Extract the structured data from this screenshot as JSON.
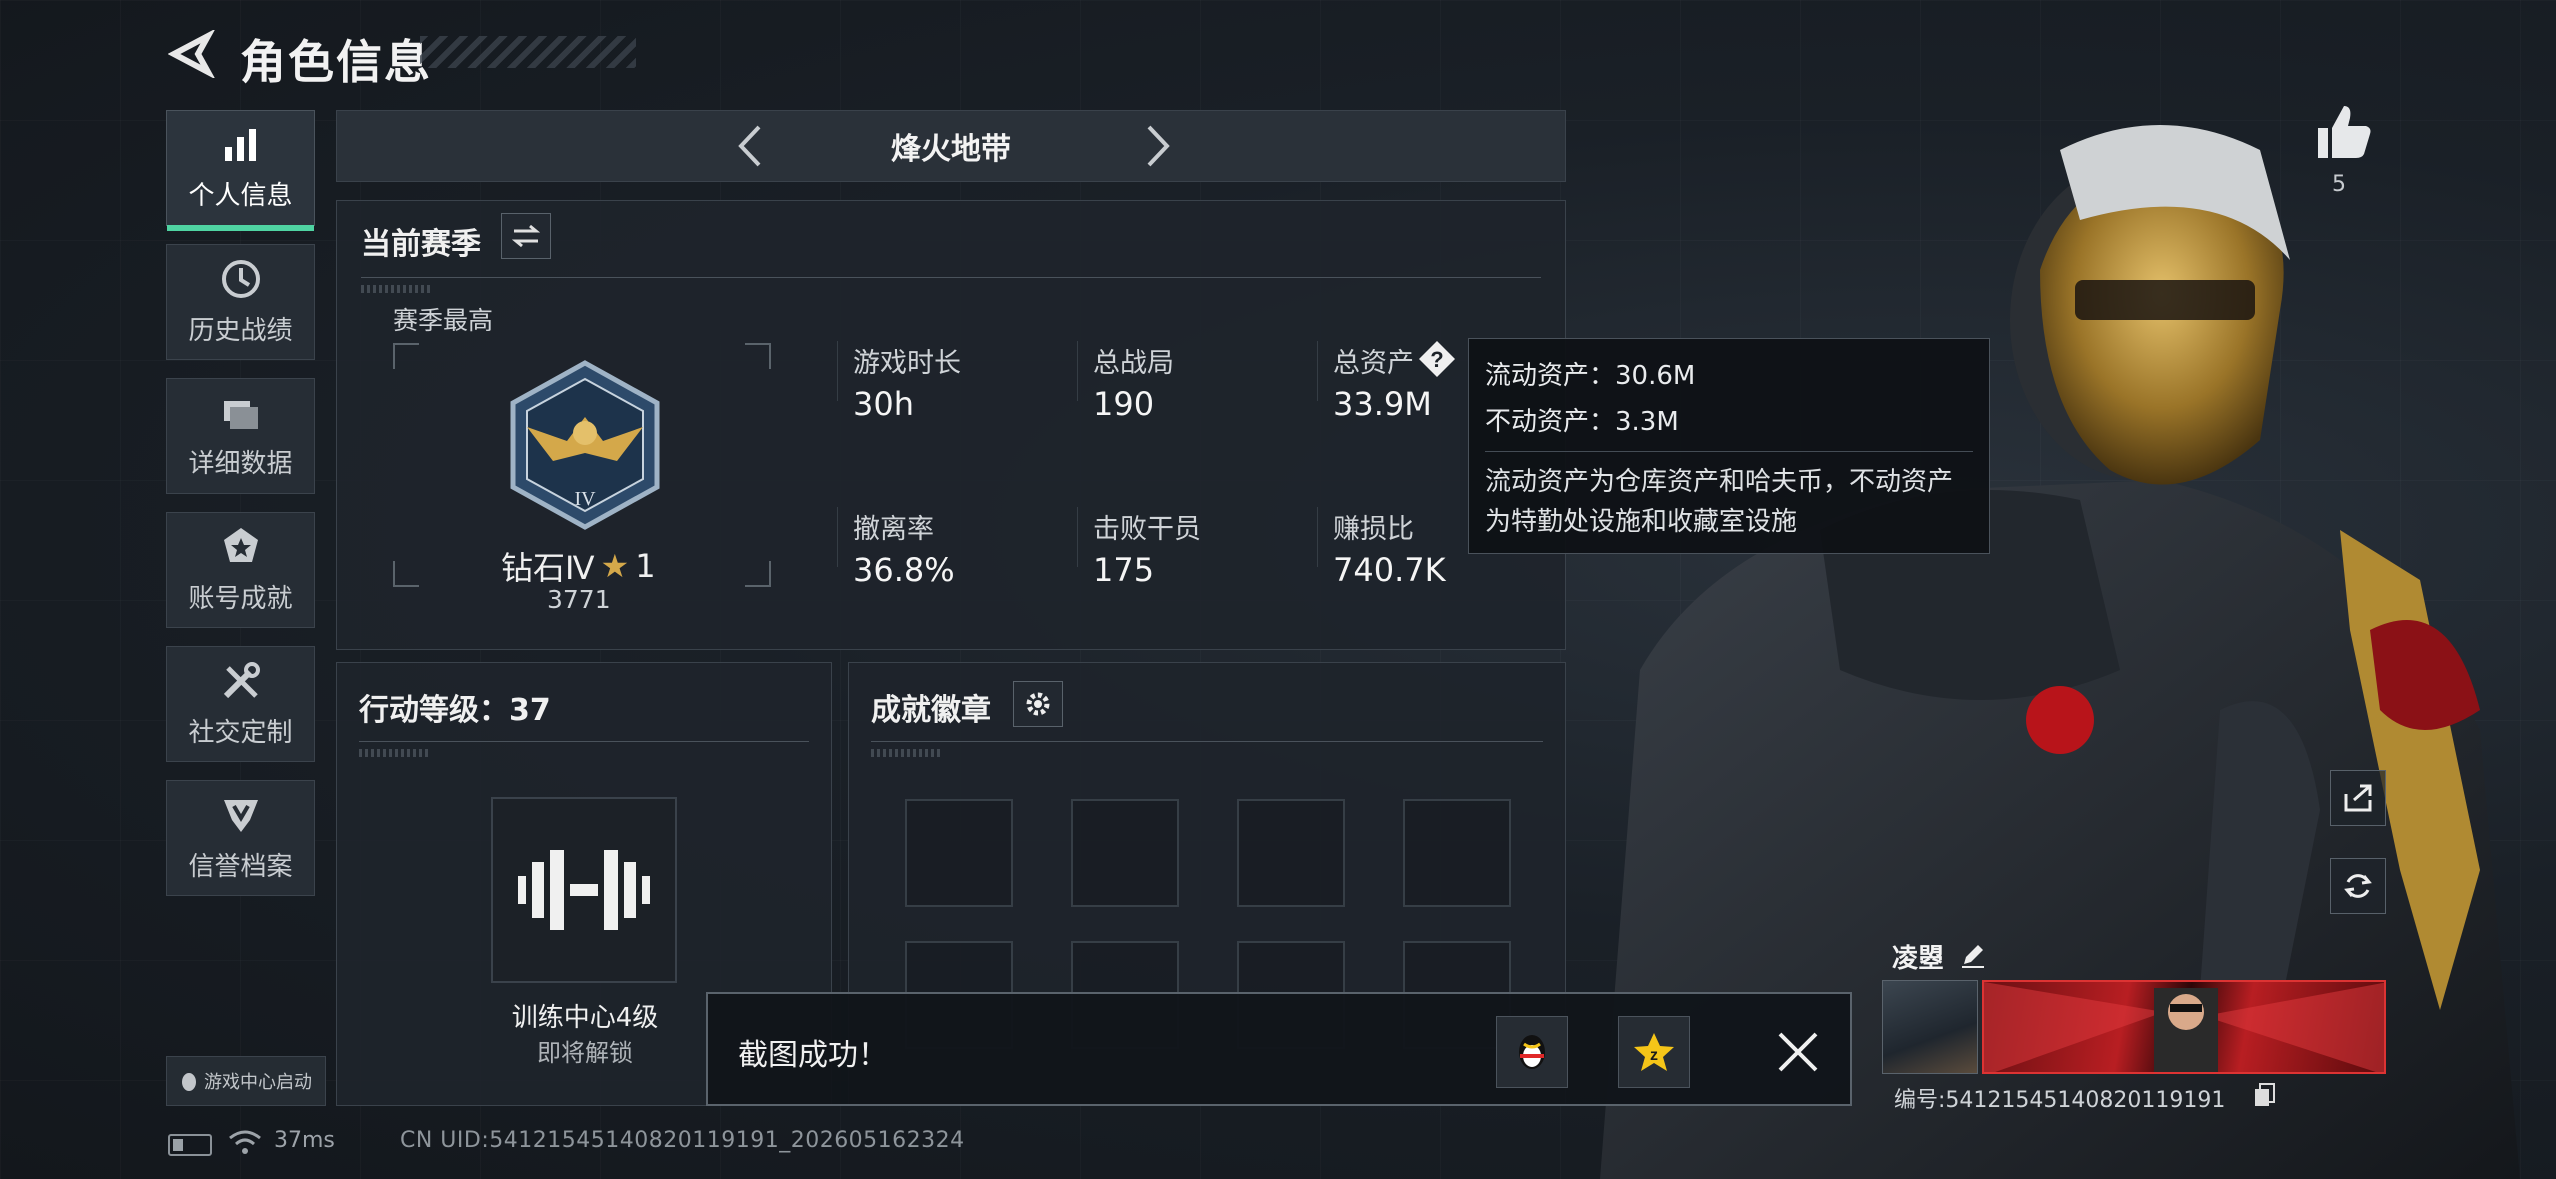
{
  "header": {
    "title": "角色信息"
  },
  "sidebar": {
    "items": [
      {
        "label": "个人信息",
        "icon": "bar-chart-icon",
        "active": true
      },
      {
        "label": "历史战绩",
        "icon": "clock-icon"
      },
      {
        "label": "详细数据",
        "icon": "folder-icon"
      },
      {
        "label": "账号成就",
        "icon": "medal-icon"
      },
      {
        "label": "社交定制",
        "icon": "tools-icon"
      },
      {
        "label": "信誉档案",
        "icon": "shield-icon"
      }
    ],
    "launch_label": "游戏中心启动"
  },
  "mode": {
    "title": "烽火地带"
  },
  "season": {
    "title": "当前赛季",
    "best_label": "赛季最高",
    "rank_name": "钻石Ⅳ",
    "rank_stars": "1",
    "rank_score": "3771",
    "stats": [
      {
        "label": "游戏时长",
        "value": "30h"
      },
      {
        "label": "总战局",
        "value": "190"
      },
      {
        "label": "总资产",
        "value": "33.9M"
      },
      {
        "label": "撤离率",
        "value": "36.8%"
      },
      {
        "label": "击败干员",
        "value": "175"
      },
      {
        "label": "赚损比",
        "value": "740.7K"
      }
    ]
  },
  "tooltip": {
    "liquid": "流动资产：30.6M",
    "fixed": "不动资产：3.3M",
    "desc_line1": "流动资产为仓库资产和哈夫币，不动资产",
    "desc_line2": "为特勤处设施和收藏室设施"
  },
  "action": {
    "title": "行动等级：37",
    "facility_name": "训练中心4级",
    "facility_status": "即将解锁"
  },
  "achievements": {
    "title": "成就徽章"
  },
  "toast": {
    "text": "截图成功！"
  },
  "profile": {
    "likes": "5",
    "name": "凌曌",
    "id_text": "编号:5412154514082011919​1"
  },
  "status": {
    "ping": "37ms",
    "uid": "CN UID:5412154514082011919​1_202605162324"
  },
  "colors": {
    "accent": "#4fd3a2",
    "gold": "#d4a84a"
  }
}
